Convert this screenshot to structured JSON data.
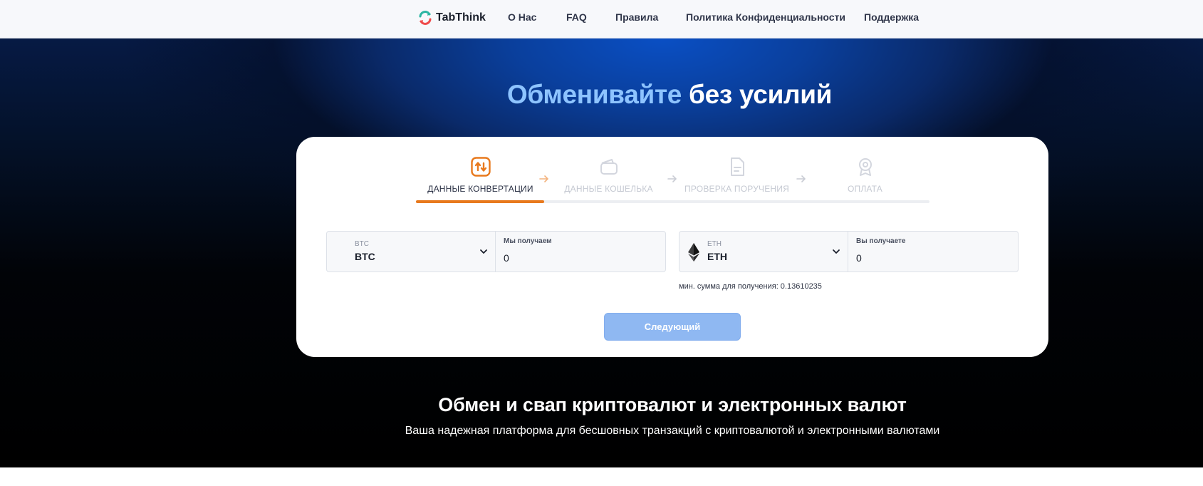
{
  "nav": {
    "logo_text": "TabThink",
    "links": [
      "О Нас",
      "FAQ",
      "Правила",
      "Политика Конфиденциальности",
      "Поддержка"
    ]
  },
  "hero": {
    "title_part1": "Обменивайте",
    "title_part2": "без усилий"
  },
  "steps": [
    {
      "label": "ДАННЫЕ КОНВЕРТАЦИИ",
      "icon": "swap-icon",
      "state": "active"
    },
    {
      "label": "ДАННЫЕ КОШЕЛЬКА",
      "icon": "wallet-icon",
      "state": "inactive"
    },
    {
      "label": "ПРОВЕРКА ПОРУЧЕНИЯ",
      "icon": "document-icon",
      "state": "inactive"
    },
    {
      "label": "ОПЛАТА",
      "icon": "badge-icon",
      "state": "inactive"
    }
  ],
  "progress": 0.25,
  "send": {
    "currency_small": "BTC",
    "currency": "BTC",
    "amount_label": "Мы получаем",
    "amount_value": "0"
  },
  "receive": {
    "currency_small": "ETH",
    "currency": "ETH",
    "amount_label": "Вы получаете",
    "amount_value": "0"
  },
  "min_note": "мин. сумма для получения: 0.13610235",
  "next_button": "Следующий",
  "section": {
    "title": "Обмен и свап криптовалют и электронных валют",
    "subtitle": "Ваша надежная платформа для бесшовных транзакций с криптовалютой и электронными валютами"
  },
  "colors": {
    "accent": "#e8791d",
    "button": "#8fb8f2",
    "title_highlight": "#8ec4ff"
  }
}
